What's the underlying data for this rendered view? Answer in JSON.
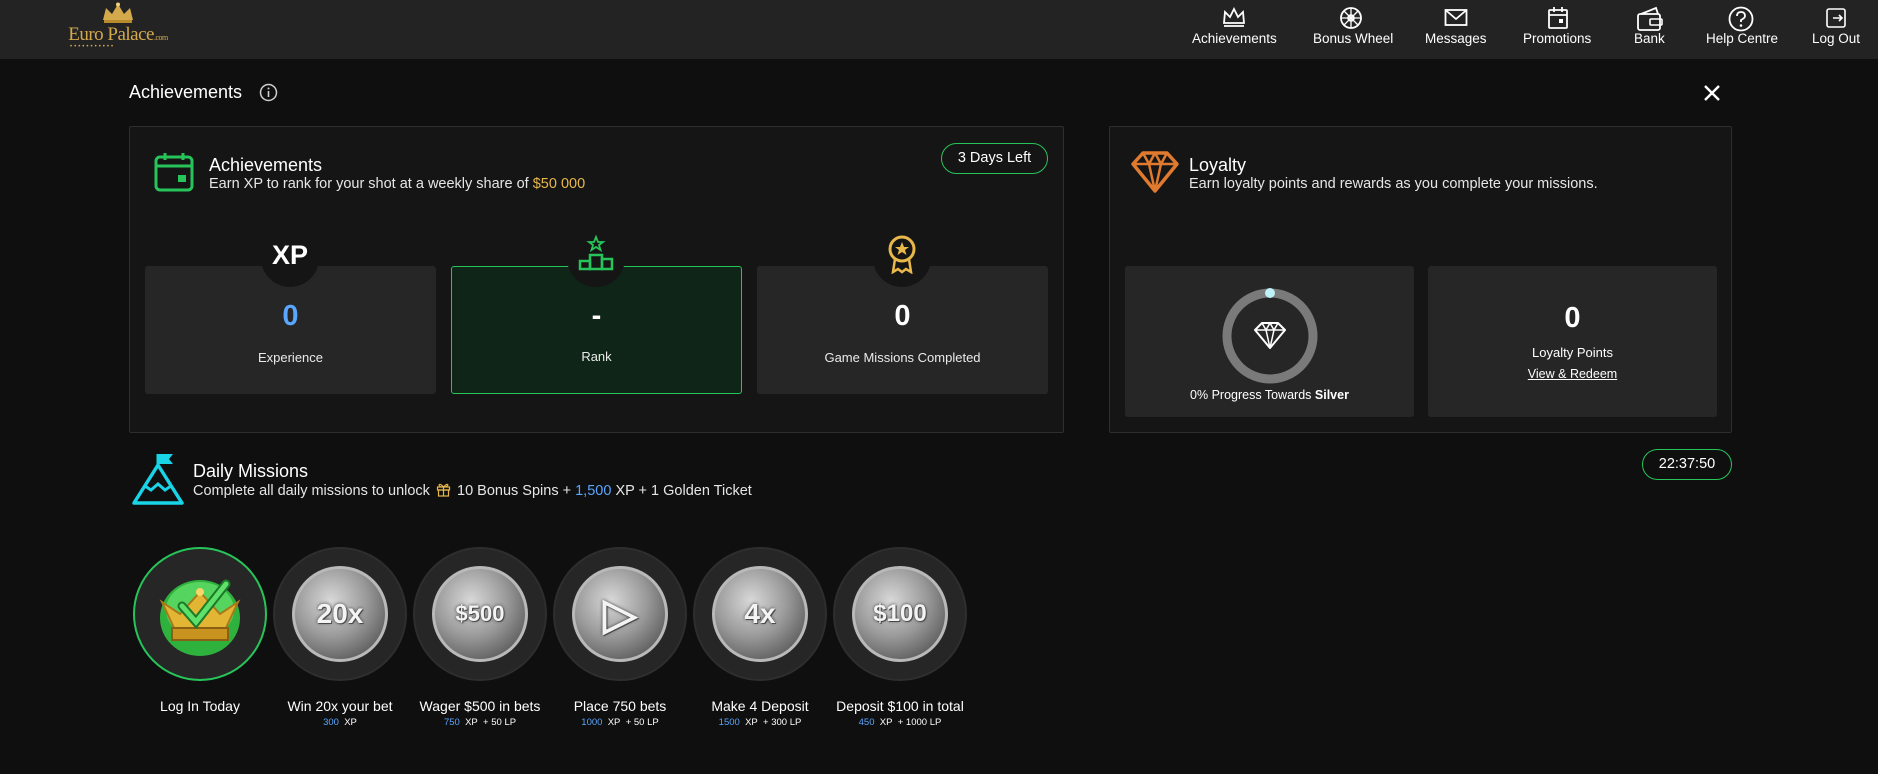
{
  "brand": {
    "name": "Euro Palace",
    "suffix": ".com"
  },
  "nav": [
    {
      "label": "Achievements",
      "icon": "crown-icon"
    },
    {
      "label": "Bonus Wheel",
      "icon": "wheel-icon"
    },
    {
      "label": "Messages",
      "icon": "envelope-icon"
    },
    {
      "label": "Promotions",
      "icon": "calendar-icon"
    },
    {
      "label": "Bank",
      "icon": "wallet-icon"
    },
    {
      "label": "Help Centre",
      "icon": "question-icon"
    },
    {
      "label": "Log Out",
      "icon": "logout-icon"
    }
  ],
  "page": {
    "title": "Achievements"
  },
  "achievements": {
    "title": "Achievements",
    "subtitle_pre": "Earn XP to rank for your shot at a weekly share of",
    "subtitle_amount": "$50 000",
    "days_left": "3 Days Left",
    "stats": [
      {
        "badge": "XP",
        "value": "0",
        "label": "Experience"
      },
      {
        "value": "-",
        "label": "Rank"
      },
      {
        "value": "0",
        "label": "Game Missions Completed"
      }
    ]
  },
  "loyalty": {
    "title": "Loyalty",
    "subtitle": "Earn loyalty points and rewards as you complete your missions.",
    "progress_pct": 0,
    "progress_pre": "0% Progress Towards",
    "progress_tier": "Silver",
    "points_value": "0",
    "points_label": "Loyalty Points",
    "redeem_link": "View & Redeem"
  },
  "daily": {
    "title": "Daily Missions",
    "sub_pre": "Complete all daily missions to unlock",
    "sub_spins": "10 Bonus Spins +",
    "sub_xp": "1,500",
    "sub_post": "XP + 1 Golden Ticket",
    "timer": "22:37:50",
    "missions": [
      {
        "label": "Log In Today",
        "coin": "",
        "xp": "",
        "xp_unit": "",
        "lp": "",
        "done": true
      },
      {
        "label": "Win 20x your bet",
        "coin": "20x",
        "xp": "300",
        "xp_unit": "XP",
        "lp": ""
      },
      {
        "label": "Wager $500 in bets",
        "coin": "$500",
        "xp": "750",
        "xp_unit": "XP",
        "lp": "+ 50 LP"
      },
      {
        "label": "Place 750 bets",
        "coin": "▷",
        "xp": "1000",
        "xp_unit": "XP",
        "lp": "+ 50 LP"
      },
      {
        "label": "Make 4 Deposit",
        "coin": "4x",
        "xp": "1500",
        "xp_unit": "XP",
        "lp": "+ 300 LP"
      },
      {
        "label": "Deposit $100 in total",
        "coin": "$100",
        "xp": "450",
        "xp_unit": "XP",
        "lp": "+ 1000 LP"
      }
    ]
  },
  "colors": {
    "accent_green": "#27c45a",
    "gold": "#e8b84a",
    "blue": "#5aa6ff",
    "orange": "#e07a2e",
    "cyan": "#19d3e6"
  }
}
